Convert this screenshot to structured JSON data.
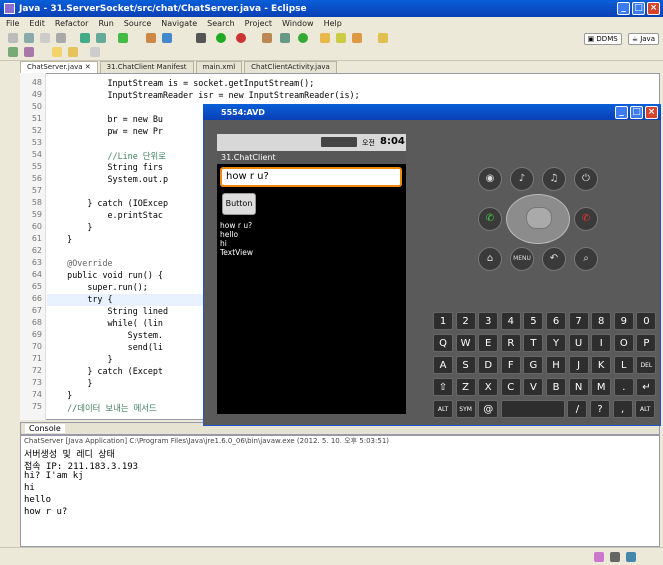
{
  "window": {
    "title": "Java - 31.ServerSocket/src/chat/ChatServer.java - Eclipse"
  },
  "menu": [
    "File",
    "Edit",
    "Refactor",
    "Run",
    "Source",
    "Navigate",
    "Search",
    "Project",
    "Window",
    "Help"
  ],
  "perspectives": {
    "ddms": "DDMS",
    "java": "Java"
  },
  "tabs": [
    "ChatServer.java",
    "31.ChatClient Manifest",
    "main.xml",
    "ChatClientActivity.java"
  ],
  "code": {
    "lines": [
      {
        "n": "48",
        "t": "            InputStream is = socket.getInputStream();"
      },
      {
        "n": "49",
        "t": "            InputStreamReader isr = new InputStreamReader(is);"
      },
      {
        "n": "50",
        "t": ""
      },
      {
        "n": "51",
        "t": "            br = new Bu"
      },
      {
        "n": "52",
        "t": "            pw = new Pr"
      },
      {
        "n": "53",
        "t": ""
      },
      {
        "n": "54",
        "t": "            //Line 단위로"
      },
      {
        "n": "55",
        "t": "            String firs"
      },
      {
        "n": "56",
        "t": "            System.out.p"
      },
      {
        "n": "57",
        "t": ""
      },
      {
        "n": "58",
        "t": "        } catch (IOExcep"
      },
      {
        "n": "59",
        "t": "            e.printStac"
      },
      {
        "n": "60",
        "t": "        }"
      },
      {
        "n": "61",
        "t": "    }"
      },
      {
        "n": "62",
        "t": ""
      },
      {
        "n": "63",
        "t": "    @Override"
      },
      {
        "n": "64",
        "t": "    public void run() {"
      },
      {
        "n": "65",
        "t": "        super.run();"
      },
      {
        "n": "66",
        "t": "        try {"
      },
      {
        "n": "67",
        "t": "            String lined"
      },
      {
        "n": "68",
        "t": "            while( (lin"
      },
      {
        "n": "69",
        "t": "                System."
      },
      {
        "n": "70",
        "t": "                send(li"
      },
      {
        "n": "71",
        "t": "            }"
      },
      {
        "n": "72",
        "t": "        } catch (Except"
      },
      {
        "n": "73",
        "t": "        }"
      },
      {
        "n": "74",
        "t": "    }"
      },
      {
        "n": "75",
        "t": "    //데이터 보내는 메서드"
      }
    ]
  },
  "console": {
    "tab": "Console",
    "header": "ChatServer [Java Application] C:\\Program Files\\Java\\jre1.6.0_06\\bin\\javaw.exe (2012. 5. 10. 오후 5:03:51)",
    "lines": [
      "서버생성 및 레디 상태",
      "접속 IP: 211.183.3.193",
      "hi? I'am kj",
      "hi",
      "hello",
      "how r u?"
    ]
  },
  "emulator": {
    "title": "5554:AVD",
    "time": "8:04",
    "ampm": "오전",
    "app_title": "31.ChatClient",
    "input_value": "how r u?",
    "button_label": "Button",
    "messages": [
      "how r u?",
      "hello",
      "hi",
      "TextView"
    ]
  },
  "keyboard": {
    "row1": [
      "1",
      "2",
      "3",
      "4",
      "5",
      "6",
      "7",
      "8",
      "9",
      "0"
    ],
    "row2": [
      "Q",
      "W",
      "E",
      "R",
      "T",
      "Y",
      "U",
      "I",
      "O",
      "P"
    ],
    "row3": [
      "A",
      "S",
      "D",
      "F",
      "G",
      "H",
      "J",
      "K",
      "L",
      "DEL"
    ],
    "row4": [
      "⇧",
      "Z",
      "X",
      "C",
      "V",
      "B",
      "N",
      "M",
      ".",
      "↵"
    ],
    "row5": [
      "ALT",
      "SYM",
      "@",
      "",
      "/",
      "?",
      ",",
      "ALT"
    ]
  }
}
